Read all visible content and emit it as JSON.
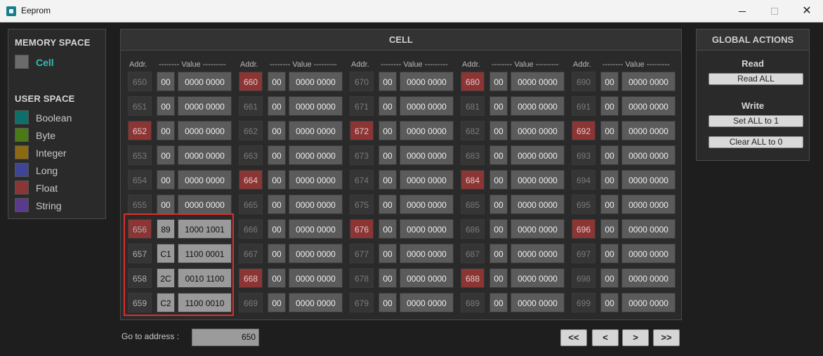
{
  "window": {
    "title": "Eeprom"
  },
  "memory_space": {
    "title": "MEMORY SPACE",
    "items": [
      {
        "label": "Cell",
        "color": "#6b6b6b"
      }
    ]
  },
  "user_space": {
    "title": "USER SPACE",
    "items": [
      {
        "label": "Boolean",
        "color": "#0e6f6a"
      },
      {
        "label": "Byte",
        "color": "#4a7a16"
      },
      {
        "label": "Integer",
        "color": "#8b6b12"
      },
      {
        "label": "Long",
        "color": "#3e4596"
      },
      {
        "label": "Float",
        "color": "#8c3535"
      },
      {
        "label": "String",
        "color": "#5a3a8c"
      }
    ]
  },
  "cell_panel": {
    "title": "CELL",
    "addr_header": "Addr.",
    "value_header": "-------- Value ---------",
    "columns": [
      {
        "rows": [
          {
            "addr": "650",
            "hex": "00",
            "bin": "0000 0000",
            "type": "cell"
          },
          {
            "addr": "651",
            "hex": "00",
            "bin": "0000 0000",
            "type": "cell"
          },
          {
            "addr": "652",
            "hex": "00",
            "bin": "0000 0000",
            "type": "float"
          },
          {
            "addr": "653",
            "hex": "00",
            "bin": "0000 0000",
            "type": "cell"
          },
          {
            "addr": "654",
            "hex": "00",
            "bin": "0000 0000",
            "type": "cell"
          },
          {
            "addr": "655",
            "hex": "00",
            "bin": "0000 0000",
            "type": "cell"
          },
          {
            "addr": "656",
            "hex": "89",
            "bin": "1000 1001",
            "type": "float",
            "hl": true
          },
          {
            "addr": "657",
            "hex": "C1",
            "bin": "1100 0001",
            "type": "cell",
            "hl": true
          },
          {
            "addr": "658",
            "hex": "2C",
            "bin": "0010 1100",
            "type": "cell",
            "hl": true
          },
          {
            "addr": "659",
            "hex": "C2",
            "bin": "1100 0010",
            "type": "cell",
            "hl": true
          }
        ]
      },
      {
        "rows": [
          {
            "addr": "660",
            "hex": "00",
            "bin": "0000 0000",
            "type": "float"
          },
          {
            "addr": "661",
            "hex": "00",
            "bin": "0000 0000",
            "type": "cell"
          },
          {
            "addr": "662",
            "hex": "00",
            "bin": "0000 0000",
            "type": "cell"
          },
          {
            "addr": "663",
            "hex": "00",
            "bin": "0000 0000",
            "type": "cell"
          },
          {
            "addr": "664",
            "hex": "00",
            "bin": "0000 0000",
            "type": "float"
          },
          {
            "addr": "665",
            "hex": "00",
            "bin": "0000 0000",
            "type": "cell"
          },
          {
            "addr": "666",
            "hex": "00",
            "bin": "0000 0000",
            "type": "cell"
          },
          {
            "addr": "667",
            "hex": "00",
            "bin": "0000 0000",
            "type": "cell"
          },
          {
            "addr": "668",
            "hex": "00",
            "bin": "0000 0000",
            "type": "float"
          },
          {
            "addr": "669",
            "hex": "00",
            "bin": "0000 0000",
            "type": "cell"
          }
        ]
      },
      {
        "rows": [
          {
            "addr": "670",
            "hex": "00",
            "bin": "0000 0000",
            "type": "cell"
          },
          {
            "addr": "671",
            "hex": "00",
            "bin": "0000 0000",
            "type": "cell"
          },
          {
            "addr": "672",
            "hex": "00",
            "bin": "0000 0000",
            "type": "float"
          },
          {
            "addr": "673",
            "hex": "00",
            "bin": "0000 0000",
            "type": "cell"
          },
          {
            "addr": "674",
            "hex": "00",
            "bin": "0000 0000",
            "type": "cell"
          },
          {
            "addr": "675",
            "hex": "00",
            "bin": "0000 0000",
            "type": "cell"
          },
          {
            "addr": "676",
            "hex": "00",
            "bin": "0000 0000",
            "type": "float"
          },
          {
            "addr": "677",
            "hex": "00",
            "bin": "0000 0000",
            "type": "cell"
          },
          {
            "addr": "678",
            "hex": "00",
            "bin": "0000 0000",
            "type": "cell"
          },
          {
            "addr": "679",
            "hex": "00",
            "bin": "0000 0000",
            "type": "cell"
          }
        ]
      },
      {
        "rows": [
          {
            "addr": "680",
            "hex": "00",
            "bin": "0000 0000",
            "type": "float"
          },
          {
            "addr": "681",
            "hex": "00",
            "bin": "0000 0000",
            "type": "cell"
          },
          {
            "addr": "682",
            "hex": "00",
            "bin": "0000 0000",
            "type": "cell"
          },
          {
            "addr": "683",
            "hex": "00",
            "bin": "0000 0000",
            "type": "cell"
          },
          {
            "addr": "684",
            "hex": "00",
            "bin": "0000 0000",
            "type": "float"
          },
          {
            "addr": "685",
            "hex": "00",
            "bin": "0000 0000",
            "type": "cell"
          },
          {
            "addr": "686",
            "hex": "00",
            "bin": "0000 0000",
            "type": "cell"
          },
          {
            "addr": "687",
            "hex": "00",
            "bin": "0000 0000",
            "type": "cell"
          },
          {
            "addr": "688",
            "hex": "00",
            "bin": "0000 0000",
            "type": "float"
          },
          {
            "addr": "689",
            "hex": "00",
            "bin": "0000 0000",
            "type": "cell"
          }
        ]
      },
      {
        "rows": [
          {
            "addr": "690",
            "hex": "00",
            "bin": "0000 0000",
            "type": "cell"
          },
          {
            "addr": "691",
            "hex": "00",
            "bin": "0000 0000",
            "type": "cell"
          },
          {
            "addr": "692",
            "hex": "00",
            "bin": "0000 0000",
            "type": "float"
          },
          {
            "addr": "693",
            "hex": "00",
            "bin": "0000 0000",
            "type": "cell"
          },
          {
            "addr": "694",
            "hex": "00",
            "bin": "0000 0000",
            "type": "cell"
          },
          {
            "addr": "695",
            "hex": "00",
            "bin": "0000 0000",
            "type": "cell"
          },
          {
            "addr": "696",
            "hex": "00",
            "bin": "0000 0000",
            "type": "float"
          },
          {
            "addr": "697",
            "hex": "00",
            "bin": "0000 0000",
            "type": "cell"
          },
          {
            "addr": "698",
            "hex": "00",
            "bin": "0000 0000",
            "type": "cell"
          },
          {
            "addr": "699",
            "hex": "00",
            "bin": "0000 0000",
            "type": "cell"
          }
        ]
      }
    ]
  },
  "navigation": {
    "goto_label": "Go to address :",
    "goto_value": "650",
    "buttons": [
      "<<",
      "<",
      ">",
      ">>"
    ]
  },
  "global_actions": {
    "title": "GLOBAL ACTIONS",
    "read_label": "Read",
    "read_all": "Read ALL",
    "write_label": "Write",
    "set_all": "Set ALL to 1",
    "clear_all": "Clear ALL to 0"
  }
}
